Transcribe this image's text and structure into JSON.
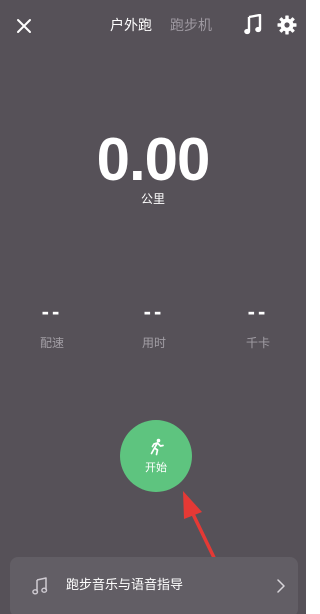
{
  "header": {
    "close_icon": "close-icon",
    "tabs": [
      {
        "label": "户外跑",
        "active": true
      },
      {
        "label": "跑步机",
        "active": false
      }
    ],
    "music_icon": "music-note-icon",
    "settings_icon": "gear-icon"
  },
  "distance": {
    "value": "0.00",
    "unit": "公里"
  },
  "stats": [
    {
      "value": "--",
      "label": "配速"
    },
    {
      "value": "--",
      "label": "用时"
    },
    {
      "value": "--",
      "label": "千卡"
    }
  ],
  "start_button": {
    "label": "开始",
    "icon": "running-icon",
    "color": "#5ec47f"
  },
  "bottom_bar": {
    "icon": "music-note-icon",
    "label": "跑步音乐与语音指导",
    "chevron": "chevron-right-icon"
  },
  "annotation": {
    "color": "#e53935",
    "icon": "red-arrow-icon"
  },
  "colors": {
    "background": "#565158",
    "accent": "#5ec47f"
  }
}
